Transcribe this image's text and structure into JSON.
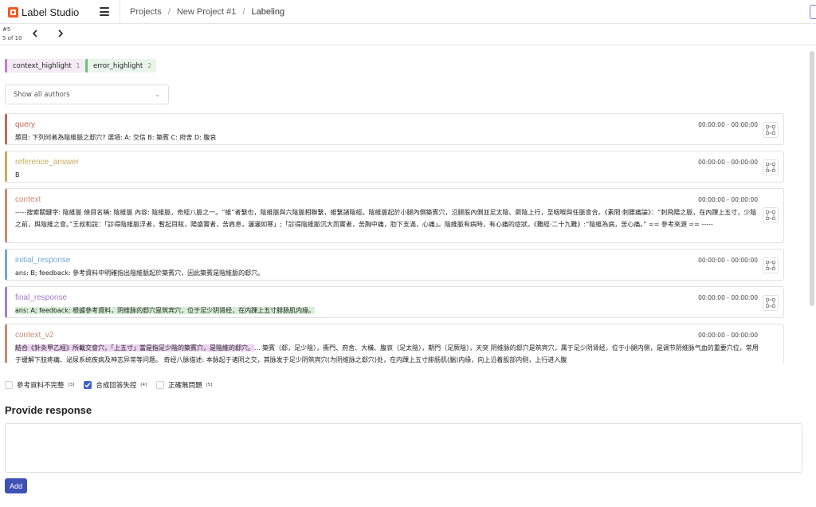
{
  "app": {
    "title": "Label Studio"
  },
  "breadcrumb": {
    "projects": "Projects",
    "project": "New Project #1",
    "page": "Labeling",
    "separator": "/"
  },
  "task": {
    "id": "#5",
    "position": "5 of 10"
  },
  "labels": [
    {
      "name": "context_highlight",
      "count": "1",
      "color": "#c27bd1"
    },
    {
      "name": "error_highlight",
      "count": "2",
      "color": "#6cbf6e"
    }
  ],
  "author_filter": {
    "selected": "Show all authors"
  },
  "fields": {
    "query": {
      "name": "query",
      "color": "#c06a5a",
      "time": "00:00:00 - 00:00:00",
      "text": "題目: 下列何者為陰維脈之郄穴? 選項: A: 交信 B: 築賓 C: 府舍 D: 腹哀"
    },
    "reference_answer": {
      "name": "reference_answer",
      "color": "#c7aa5c",
      "time": "00:00:00 - 00:00:00",
      "text": "B"
    },
    "context": {
      "name": "context",
      "color": "#c78a78",
      "time": "00:00:00 - 00:00:00",
      "text": "-----搜索關鍵字: 陰維脈 條目名稱: 陰維脈 內容: 陰維脈，奇經八脈之一。“維”者繫也，陰維脈與六陰脈相聯繫，維繫諸陰經。陰維脈起於小腿內側築賓穴，沿腿股內側並足太陰、厥陰上行，至咽喉與任脈會合。《素問·刺腰痛論》：“刺飛陽之脈，在內踝上五寸，少陰之前，與陰維之會。”王叔和說：「診得陰維脈浮者，暫起目眩，陽盛實者，苦肩息，灑灑如寒」;「診得陰維脈沉大而實者，苦胸中痛，肋下支滿，心痛」。陰維脈有病時，有心痛的症狀。《難經·二十九難》:“陰維為病，苦心痛。” == 參考來源 == -----"
    },
    "initial_response": {
      "name": "initial_response",
      "color": "#6fa9cf",
      "time": "00:00:00 - 00:00:00",
      "text": "ans: B; feedback: 參考資料中明確指出陰維脈起於築賓穴，因此築賓是陰維脈的郄穴。"
    },
    "final_response": {
      "name": "final_response",
      "color": "#a57cc8",
      "time": "00:00:00 - 00:00:00",
      "prefix": "ans: A; feedback: ",
      "highlight": "根據參考資料，阴维脉的郄穴是筑宾穴，位于足少阴肾经，在内踝上五寸腓肠肌内缘。"
    },
    "context_v2": {
      "name": "context_v2",
      "color": "#c78a78",
      "time": "00:00:00 - 00:00:00",
      "highlight": "結合《針灸甲乙經》所載交會穴，「上五寸」當是指足少陰的築賓穴，是陰維的郄穴。",
      "text": "... 築賓（郄，足少陰），衝門、府舍、大橫、腹哀（足太陰），期門（足厥陰），天突 阴维脉的郄穴是筑宾穴，属于足少阴肾经，位于小腿内侧，是调节阴维脉气血的重要穴位，常用于缓解下肢疼痛、泌尿系统疾病及神志异常等问题。 奇经八脉描述: 本脉起于诸阴之交，其脉发于足少阴筑宾穴(为阴维脉之郄穴)处，在内踝上五寸腓肠肌(腨)内缘，向上沿着股部内侧，上行进入腹"
    }
  },
  "choices": [
    {
      "label": "參考資料不完整",
      "hotkey": "[3]",
      "checked": false
    },
    {
      "label": "合成回答失控",
      "hotkey": "[4]",
      "checked": true
    },
    {
      "label": "正確無問題",
      "hotkey": "[5]",
      "checked": false
    }
  ],
  "response": {
    "title": "Provide response",
    "value": "",
    "add_label": "Add"
  }
}
